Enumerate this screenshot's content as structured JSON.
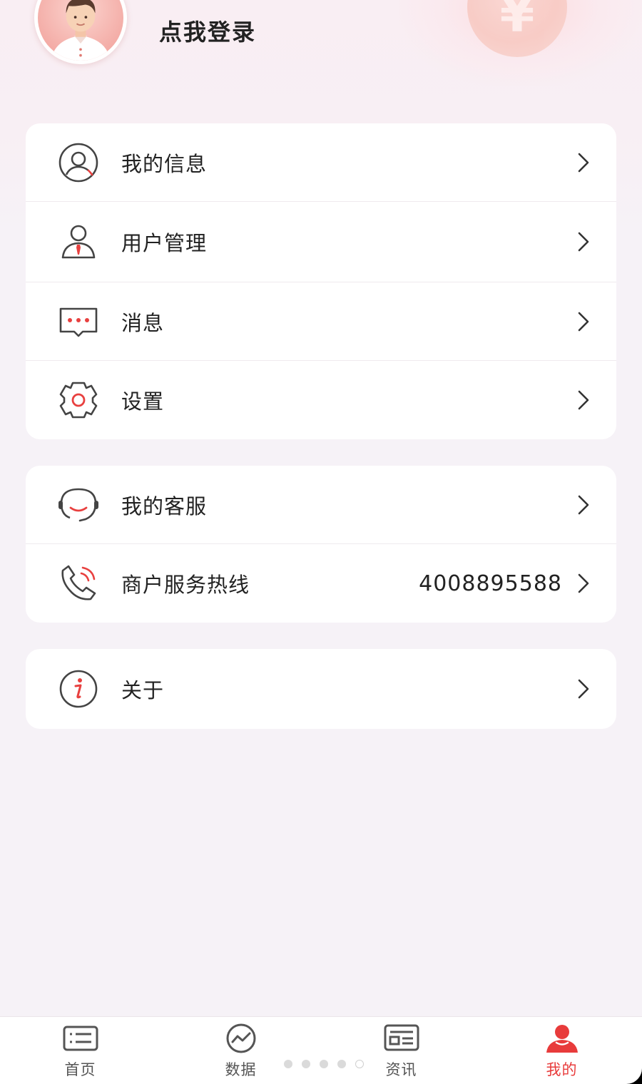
{
  "header": {
    "login_text": "点我登录"
  },
  "menu_group_1": [
    {
      "label": "我的信息",
      "icon": "user-circle-icon"
    },
    {
      "label": "用户管理",
      "icon": "user-manage-icon"
    },
    {
      "label": "消息",
      "icon": "message-icon"
    },
    {
      "label": "设置",
      "icon": "gear-icon"
    }
  ],
  "menu_group_2": [
    {
      "label": "我的客服",
      "icon": "headset-icon"
    },
    {
      "label": "商户服务热线",
      "icon": "phone-icon",
      "value": "4008895588"
    }
  ],
  "menu_group_3": [
    {
      "label": "关于",
      "icon": "info-icon"
    }
  ],
  "tabbar": {
    "tabs": [
      {
        "label": "首页",
        "icon": "home-list-icon",
        "active": false
      },
      {
        "label": "数据",
        "icon": "chart-icon",
        "active": false
      },
      {
        "label": "资讯",
        "icon": "news-icon",
        "active": false
      },
      {
        "label": "我的",
        "icon": "person-icon",
        "active": true
      }
    ]
  },
  "colors": {
    "accent": "#e83b3b",
    "background": "#f6f2f7",
    "card": "#ffffff",
    "icon_stroke": "#444444"
  }
}
